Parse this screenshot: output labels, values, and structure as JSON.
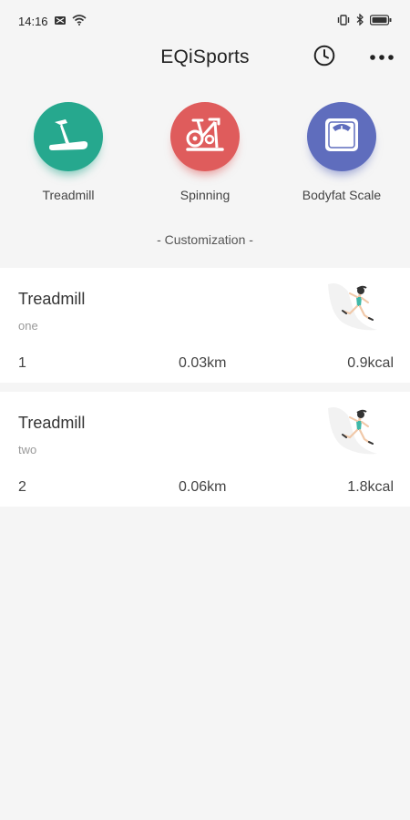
{
  "status_bar": {
    "time": "14:16",
    "icons": [
      "notification-icon",
      "wifi-icon",
      "vibrate-icon",
      "bluetooth-icon",
      "battery-icon"
    ]
  },
  "header": {
    "title": "EQiSports",
    "history_icon": "clock-icon",
    "more_icon": "more-dots-icon"
  },
  "devices": [
    {
      "label": "Treadmill",
      "icon": "treadmill-icon",
      "color": "#26a88e"
    },
    {
      "label": "Spinning",
      "icon": "exercise-bike-icon",
      "color": "#df5c5c"
    },
    {
      "label": "Bodyfat Scale",
      "icon": "scale-icon",
      "color": "#5f6dbd"
    }
  ],
  "customization_label": "- Customization -",
  "records": [
    {
      "title": "Treadmill",
      "subtitle": "one",
      "count": "1",
      "distance": "0.03km",
      "calories": "0.9kcal"
    },
    {
      "title": "Treadmill",
      "subtitle": "two",
      "count": "2",
      "distance": "0.06km",
      "calories": "1.8kcal"
    }
  ]
}
